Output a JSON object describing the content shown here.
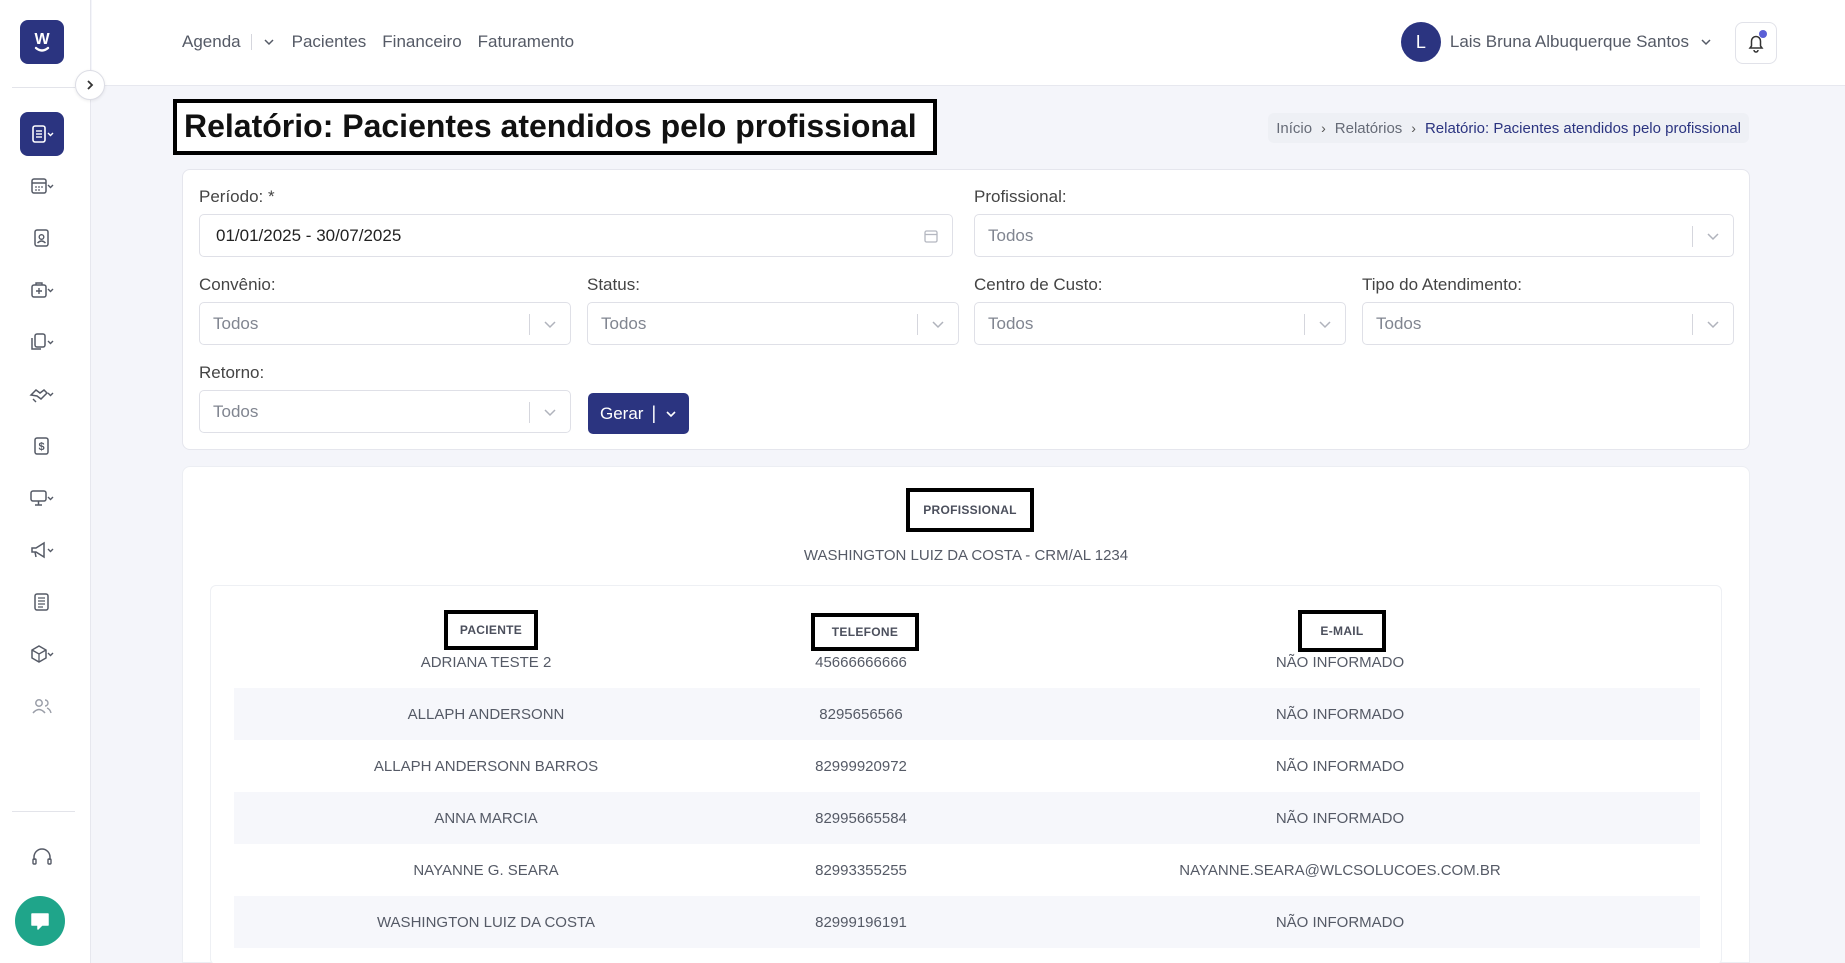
{
  "topnav": {
    "agenda": "Agenda",
    "pacientes": "Pacientes",
    "financeiro": "Financeiro",
    "faturamento": "Faturamento"
  },
  "user": {
    "initial": "L",
    "name": "Lais Bruna Albuquerque Santos"
  },
  "page": {
    "title": "Relatório: Pacientes atendidos pelo profissional"
  },
  "breadcrumb": {
    "home": "Início",
    "reports": "Relatórios",
    "current": "Relatório: Pacientes atendidos pelo profissional"
  },
  "filters": {
    "periodo_label": "Período: *",
    "periodo_value": "01/01/2025 - 30/07/2025",
    "profissional_label": "Profissional:",
    "profissional_value": "Todos",
    "convenio_label": "Convênio:",
    "convenio_value": "Todos",
    "status_label": "Status:",
    "status_value": "Todos",
    "centro_label": "Centro de Custo:",
    "centro_value": "Todos",
    "tipo_label": "Tipo do Atendimento:",
    "tipo_value": "Todos",
    "retorno_label": "Retorno:",
    "retorno_value": "Todos",
    "generate_label": "Gerar"
  },
  "report": {
    "profissional_header": "PROFISSIONAL",
    "profissional_name": "WASHINGTON LUIZ DA COSTA - CRM/AL 1234",
    "columns": [
      "PACIENTE",
      "TELEFONE",
      "E-MAIL"
    ],
    "rows": [
      [
        "ADRIANA TESTE 2",
        "45666666666",
        "NÃO INFORMADO"
      ],
      [
        "ALLAPH ANDERSONN",
        "8295656566",
        "NÃO INFORMADO"
      ],
      [
        "ALLAPH ANDERSONN BARROS",
        "82999920972",
        "NÃO INFORMADO"
      ],
      [
        "ANNA MARCIA",
        "82995665584",
        "NÃO INFORMADO"
      ],
      [
        "NAYANNE G. SEARA",
        "82993355255",
        "NAYANNE.SEARA@WLCSOLUCOES.COM.BR"
      ],
      [
        "WASHINGTON LUIZ DA COSTA",
        "82999196191",
        "NÃO INFORMADO"
      ]
    ]
  },
  "colors": {
    "primary": "#2b3480",
    "chat": "#1fa58a"
  },
  "icons": {
    "sidebar": [
      "report-icon",
      "calendar-icon",
      "patient-badge-icon",
      "medical-bag-icon",
      "documents-icon",
      "handshake-icon",
      "dollar-icon",
      "monitor-icon",
      "megaphone-icon",
      "newspaper-icon",
      "box-icon",
      "users-icon",
      "headset-icon"
    ]
  }
}
